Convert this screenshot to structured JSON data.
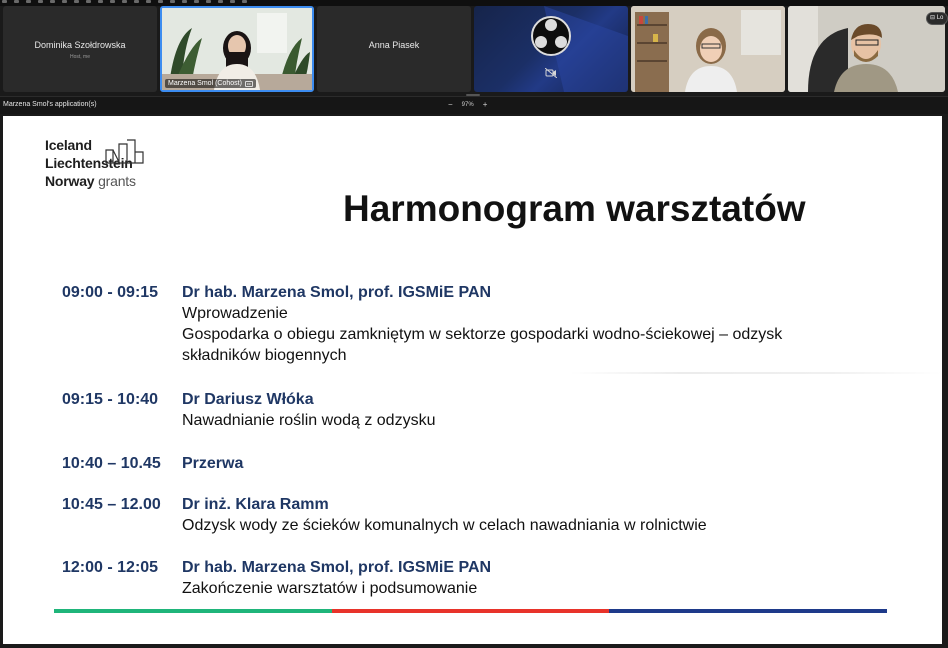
{
  "participants": [
    {
      "name": "Dominika Szołdrowska",
      "subtitle": "Host, me"
    },
    {
      "name": "Marzena Smol (Cohost)"
    },
    {
      "name": "Anna Piasek"
    },
    {
      "icon": "obs-logo-icon",
      "status": "video-off"
    },
    {
      "icon": "camera-feed"
    },
    {
      "icon": "camera-feed"
    }
  ],
  "corner_button": {
    "label": "Lo"
  },
  "share_bar": {
    "title": "Marzena Smol's application(s)",
    "zoom_minus": "−",
    "zoom_value": "97%",
    "zoom_plus": "+"
  },
  "slide": {
    "logo": {
      "line1": "Iceland",
      "line2": "Liechtenstein",
      "line3_bold": "Norway",
      "line3_light": "grants"
    },
    "title": "Harmonogram warsztatów",
    "agenda": [
      {
        "time": "09:00 - 09:15",
        "speaker": "Dr hab. Marzena Smol, prof. IGSMiE PAN",
        "lines": [
          "Wprowadzenie",
          "Gospodarka o obiegu zamkniętym w sektorze gospodarki wodno-ściekowej – odzysk",
          "składników biogennych"
        ]
      },
      {
        "time": "09:15 - 10:40",
        "speaker": "Dr Dariusz Włóka",
        "lines": [
          "Nawadnianie roślin wodą z odzysku"
        ]
      },
      {
        "time": "10:40 – 10.45",
        "speaker": "Przerwa",
        "lines": []
      },
      {
        "time": "10:45 – 12.00",
        "speaker": "Dr inż. Klara Ramm",
        "lines": [
          "Odzysk wody ze ścieków komunalnych w celach nawadniania w rolnictwie"
        ]
      },
      {
        "time": "12:00 - 12:05",
        "speaker": "Dr hab. Marzena Smol, prof. IGSMiE PAN",
        "lines": [
          "Zakończenie warsztatów i podsumowanie"
        ]
      }
    ],
    "stripe_colors": [
      "#1fb57a",
      "#e8332a",
      "#1e3a8a"
    ]
  },
  "colors": {
    "accent_blue": "#3c8cf0",
    "agenda_blue": "#1f3764"
  }
}
